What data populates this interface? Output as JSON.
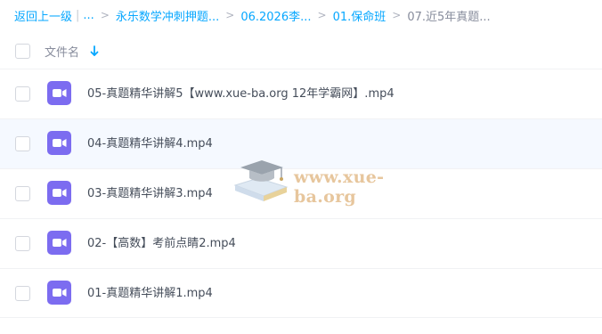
{
  "breadcrumb": {
    "back": "返回上一级",
    "pipe": "|",
    "ellipsis": "...",
    "items": [
      "永乐数学冲刺押题...",
      "06.2026李...",
      "01.保命班"
    ],
    "current": "07.近5年真题..."
  },
  "list_header": {
    "label": "文件名",
    "sort_icon": "arrow-down-icon"
  },
  "files": [
    {
      "name": "05-真题精华讲解5【www.xue-ba.org 12年学霸网】.mp4",
      "icon": "video-file-icon"
    },
    {
      "name": "04-真题精华讲解4.mp4",
      "icon": "video-file-icon"
    },
    {
      "name": "03-真题精华讲解3.mp4",
      "icon": "video-file-icon"
    },
    {
      "name": "02-【高数】考前点睛2.mp4",
      "icon": "video-file-icon"
    },
    {
      "name": "01-真题精华讲解1.mp4",
      "icon": "video-file-icon"
    }
  ],
  "watermark": {
    "text": "www.xue-ba.org"
  },
  "colors": {
    "accent": "#06a7ff",
    "video_icon": "#7c6cf0",
    "hover_row": "#f5f9ff",
    "watermark": "#e3bd8c"
  }
}
